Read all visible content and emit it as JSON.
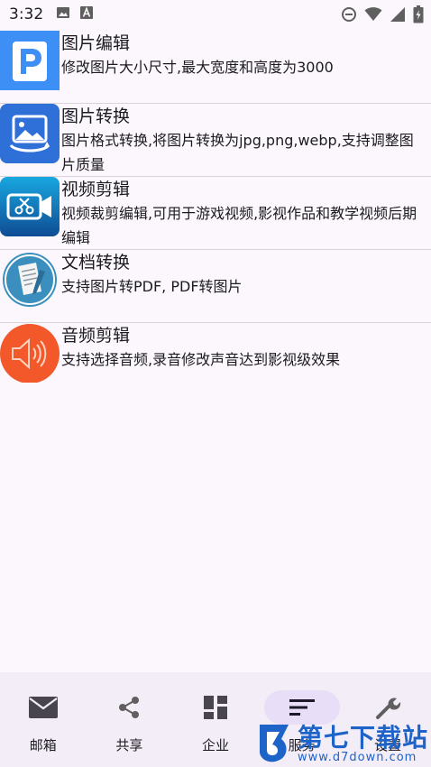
{
  "status": {
    "time": "3:32"
  },
  "list": {
    "items": [
      {
        "title": "图片编辑",
        "desc": "修改图片大小尺寸,最大宽度和高度为3000",
        "icon": "photo-edit-icon"
      },
      {
        "title": "图片转换",
        "desc": "图片格式转换,将图片转换为jpg,png,webp,支持调整图片质量",
        "icon": "image-convert-icon"
      },
      {
        "title": "视频剪辑",
        "desc": "视频裁剪编辑,可用于游戏视频,影视作品和教学视频后期编辑",
        "icon": "video-cut-icon"
      },
      {
        "title": "文档转换",
        "desc": "支持图片转PDF, PDF转图片",
        "icon": "document-convert-icon"
      },
      {
        "title": "音频剪辑",
        "desc": "支持选择音频,录音修改声音达到影视级效果",
        "icon": "audio-cut-icon"
      }
    ]
  },
  "nav": {
    "items": [
      {
        "label": "邮箱",
        "icon": "mail-icon"
      },
      {
        "label": "共享",
        "icon": "share-icon"
      },
      {
        "label": "企业",
        "icon": "dashboard-icon"
      },
      {
        "label": "服务",
        "icon": "sort-icon",
        "active": true
      },
      {
        "label": "设置",
        "icon": "wrench-icon"
      }
    ]
  },
  "watermark": {
    "main": "第七下载站",
    "url": "www.d7down.com"
  },
  "colors": {
    "background": "#fbf7fd",
    "nav_background": "#f3edf7",
    "nav_active_pill": "#e8def8",
    "watermark": "#1e63c8"
  }
}
